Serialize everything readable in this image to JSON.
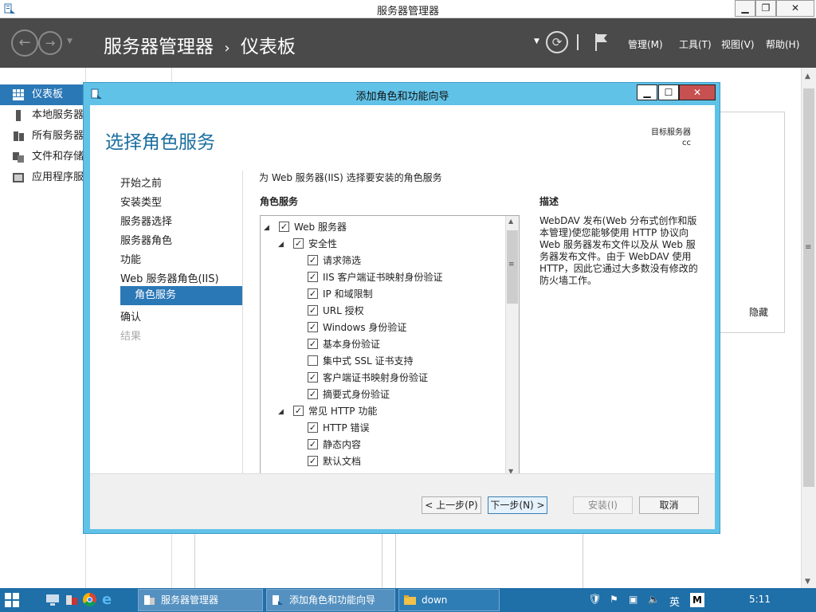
{
  "window": {
    "title": "服务器管理器"
  },
  "nav": {
    "breadcrumb_root": "服务器管理器",
    "breadcrumb_sep": "›",
    "breadcrumb_page": "仪表板",
    "menus": [
      "管理(M)",
      "工具(T)",
      "视图(V)",
      "帮助(H)"
    ]
  },
  "sidebar": {
    "items": [
      {
        "label": "仪表板",
        "icon": "dashboard-icon",
        "active": true
      },
      {
        "label": "本地服务器",
        "icon": "server-icon"
      },
      {
        "label": "所有服务器",
        "icon": "servers-icon"
      },
      {
        "label": "文件和存储服务",
        "icon": "storage-icon"
      },
      {
        "label": "应用程序服务器",
        "icon": "app-server-icon"
      }
    ]
  },
  "background": {
    "hide_label": "隐藏"
  },
  "dialog": {
    "title": "添加角色和功能向导",
    "heading": "选择角色服务",
    "target_label": "目标服务器",
    "target_value": "cc",
    "steps": [
      {
        "label": "开始之前",
        "state": "normal"
      },
      {
        "label": "安装类型",
        "state": "normal"
      },
      {
        "label": "服务器选择",
        "state": "normal"
      },
      {
        "label": "服务器角色",
        "state": "normal"
      },
      {
        "label": "功能",
        "state": "normal"
      },
      {
        "label": "Web 服务器角色(IIS)",
        "state": "normal"
      },
      {
        "label": "角色服务",
        "state": "selected"
      },
      {
        "label": "确认",
        "state": "normal"
      },
      {
        "label": "结果",
        "state": "disabled"
      }
    ],
    "instruction": "为 Web 服务器(IIS) 选择要安装的角色服务",
    "role_services_header": "角色服务",
    "description_header": "描述",
    "description_text": "WebDAV 发布(Web 分布式创作和版本管理)使您能够使用 HTTP 协议向 Web 服务器发布文件以及从 Web 服务器发布文件。由于 WebDAV 使用 HTTP，因此它通过大多数没有修改的防火墙工作。",
    "tree": [
      {
        "label": "Web 服务器",
        "level": 0,
        "checked": true,
        "expander": true
      },
      {
        "label": "安全性",
        "level": 1,
        "checked": true,
        "expander": true
      },
      {
        "label": "请求筛选",
        "level": 2,
        "checked": true
      },
      {
        "label": "IIS 客户端证书映射身份验证",
        "level": 2,
        "checked": true
      },
      {
        "label": "IP 和域限制",
        "level": 2,
        "checked": true
      },
      {
        "label": "URL 授权",
        "level": 2,
        "checked": true
      },
      {
        "label": "Windows 身份验证",
        "level": 2,
        "checked": true
      },
      {
        "label": "基本身份验证",
        "level": 2,
        "checked": true
      },
      {
        "label": "集中式 SSL 证书支持",
        "level": 2,
        "checked": false
      },
      {
        "label": "客户端证书映射身份验证",
        "level": 2,
        "checked": true
      },
      {
        "label": "摘要式身份验证",
        "level": 2,
        "checked": true
      },
      {
        "label": "常见 HTTP 功能",
        "level": 1,
        "checked": true,
        "expander": true
      },
      {
        "label": "HTTP 错误",
        "level": 2,
        "checked": true
      },
      {
        "label": "静态内容",
        "level": 2,
        "checked": true
      },
      {
        "label": "默认文档",
        "level": 2,
        "checked": true
      }
    ],
    "buttons": {
      "prev": "< 上一步(P)",
      "next": "下一步(N) >",
      "install": "安装(I)",
      "cancel": "取消"
    }
  },
  "taskbar": {
    "items": [
      {
        "label": "服务器管理器",
        "icon": "server-manager-icon"
      },
      {
        "label": "添加角色和功能向导",
        "icon": "wizard-icon"
      },
      {
        "label": "down",
        "icon": "folder-icon"
      }
    ],
    "ime": "英",
    "ime_mode": "M",
    "clock": "5:11"
  }
}
